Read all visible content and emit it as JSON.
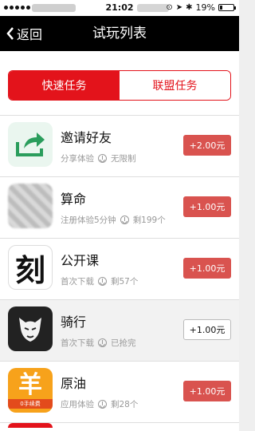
{
  "status_bar": {
    "time": "21:02",
    "battery_text": "19%",
    "battery_level": 0.19
  },
  "nav": {
    "back_label": "返回",
    "title": "试玩列表"
  },
  "segments": {
    "active": "快速任务",
    "inactive": "联盟任务"
  },
  "tasks": [
    {
      "name": "邀请好友",
      "desc": "分享体验",
      "status": "无限制",
      "reward": "+2.00元",
      "icon": "share-icon",
      "available": true
    },
    {
      "name": "算命",
      "desc": "注册体验5分钟",
      "status": "剩199个",
      "reward": "+1.00元",
      "icon": "fortune-app-icon",
      "available": true
    },
    {
      "name": "公开课",
      "desc": "首次下载",
      "status": "剩57个",
      "reward": "+1.00元",
      "icon": "course-app-icon",
      "icon_text": "刻",
      "available": true
    },
    {
      "name": "骑行",
      "desc": "首次下载",
      "status": "已抢完",
      "reward": "+1.00元",
      "icon": "panther-app-icon",
      "available": false
    },
    {
      "name": "原油",
      "desc": "应用体验",
      "status": "剩28个",
      "reward": "+1.00元",
      "icon": "oil-app-icon",
      "icon_text": "羊",
      "icon_tag": "0手续费",
      "available": true
    }
  ],
  "colors": {
    "accent": "#e3131b",
    "button": "#d9534f",
    "navbar": "#000000"
  }
}
